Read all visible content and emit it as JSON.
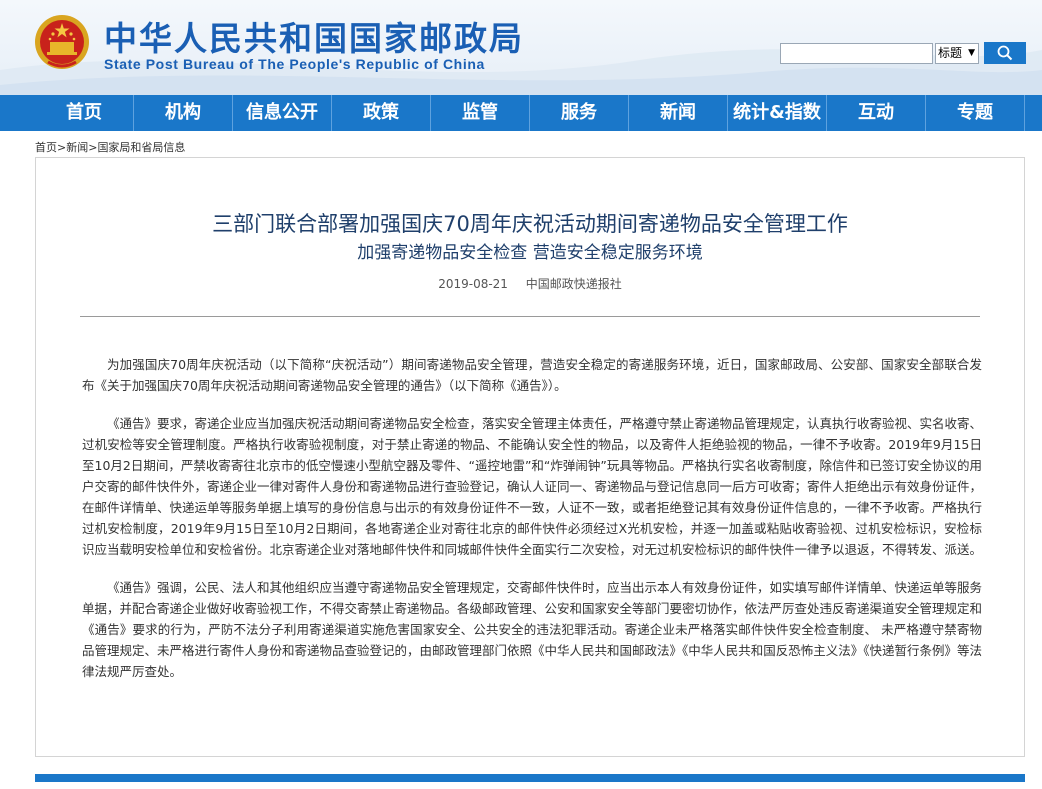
{
  "header": {
    "site_name_cn": "中华人民共和国国家邮政局",
    "site_name_en": "State Post Bureau of The People's Republic of China",
    "emblem_icon": "national-emblem-icon",
    "search": {
      "placeholder": "",
      "select_value": "标题",
      "select_arrow": "▼",
      "button_icon": "search-icon"
    }
  },
  "nav": {
    "items": [
      "首页",
      "机构",
      "信息公开",
      "政策",
      "监管",
      "服务",
      "新闻",
      "统计&指数",
      "互动",
      "专题"
    ]
  },
  "breadcrumb": {
    "items": [
      "首页",
      "新闻",
      "国家局和省局信息"
    ],
    "separator": ">"
  },
  "article": {
    "title": "三部门联合部署加强国庆70周年庆祝活动期间寄递物品安全管理工作",
    "subtitle": "加强寄递物品安全检查 营造安全稳定服务环境",
    "date": "2019-08-21",
    "source": "中国邮政快递报社",
    "paragraphs": [
      "为加强国庆70周年庆祝活动（以下简称“庆祝活动”）期间寄递物品安全管理，营造安全稳定的寄递服务环境，近日，国家邮政局、公安部、国家安全部联合发布《关于加强国庆70周年庆祝活动期间寄递物品安全管理的通告》（以下简称《通告》）。",
      "《通告》要求，寄递企业应当加强庆祝活动期间寄递物品安全检查，落实安全管理主体责任，严格遵守禁止寄递物品管理规定，认真执行收寄验视、实名收寄、过机安检等安全管理制度。严格执行收寄验视制度，对于禁止寄递的物品、不能确认安全性的物品，以及寄件人拒绝验视的物品，一律不予收寄。2019年9月15日至10月2日期间，严禁收寄寄往北京市的低空慢速小型航空器及零件、“遥控地雷”和“炸弹闹钟”玩具等物品。严格执行实名收寄制度，除信件和已签订安全协议的用户交寄的邮件快件外，寄递企业一律对寄件人身份和寄递物品进行查验登记，确认人证同一、寄递物品与登记信息同一后方可收寄；寄件人拒绝出示有效身份证件，在邮件详情单、快递运单等服务单据上填写的身份信息与出示的有效身份证件不一致，人证不一致，或者拒绝登记其有效身份证件信息的，一律不予收寄。严格执行过机安检制度，2019年9月15日至10月2日期间，各地寄递企业对寄往北京的邮件快件必须经过X光机安检，并逐一加盖或粘贴收寄验视、过机安检标识，安检标识应当载明安检单位和安检省份。北京寄递企业对落地邮件快件和同城邮件快件全面实行二次安检，对无过机安检标识的邮件快件一律予以退返，不得转发、派送。",
      "《通告》强调，公民、法人和其他组织应当遵守寄递物品安全管理规定，交寄邮件快件时，应当出示本人有效身份证件，如实填写邮件详情单、快递运单等服务单据，并配合寄递企业做好收寄验视工作，不得交寄禁止寄递物品。各级邮政管理、公安和国家安全等部门要密切协作，依法严厉查处违反寄递渠道安全管理规定和《通告》要求的行为，严防不法分子利用寄递渠道实施危害国家安全、公共安全的违法犯罪活动。寄递企业未严格落实邮件快件安全检查制度、 未严格遵守禁寄物品管理规定、未严格进行寄件人身份和寄递物品查验登记的，由邮政管理部门依照《中华人民共和国邮政法》《中华人民共和国反恐怖主义法》《快递暂行条例》等法律法规严厉查处。"
    ]
  },
  "colors": {
    "brand_blue": "#1a77c9",
    "title_blue": "#1a5fb4",
    "headline": "#1f3f6b"
  }
}
